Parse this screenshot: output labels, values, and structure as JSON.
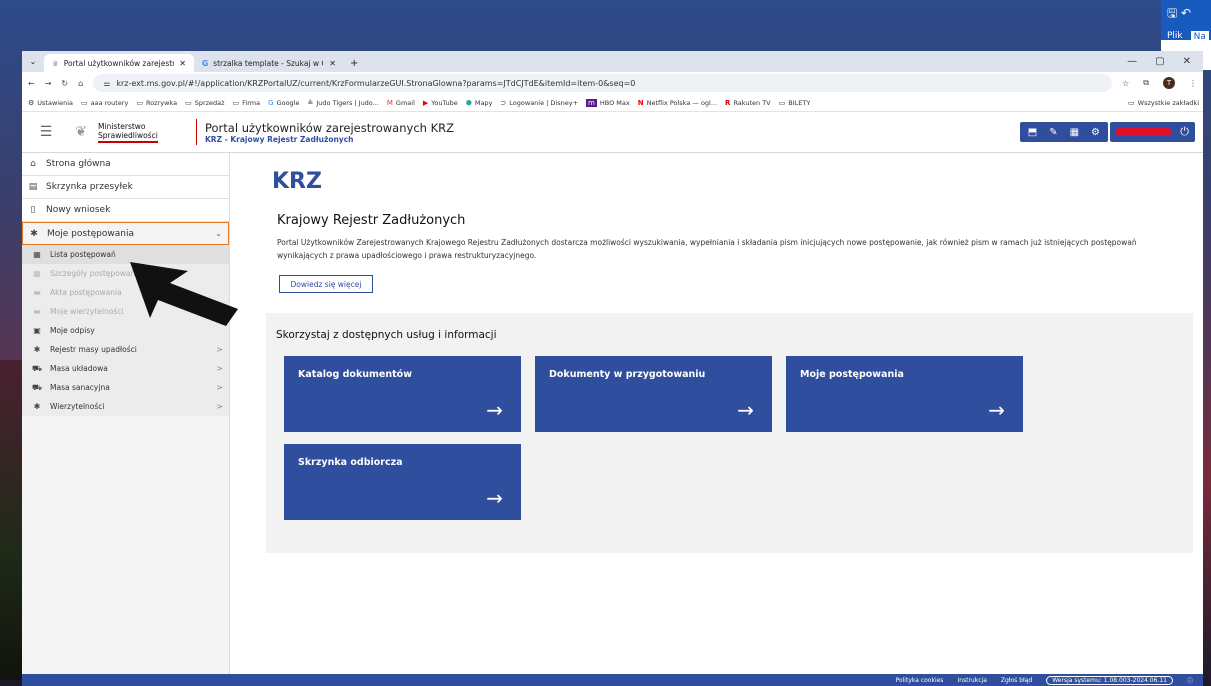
{
  "office": {
    "title_icons": "🖫 ↶",
    "tab_plik": "Plik",
    "tab_na": "Na"
  },
  "browser": {
    "tabs": [
      {
        "label": "Portal użytkowników zarejestro",
        "close": "✕"
      },
      {
        "label": "strzalka template - Szukaj w Go",
        "close": "✕"
      }
    ],
    "new_tab": "+",
    "url": "krz-ext.ms.gov.pl/#!/application/KRZPortalUZ/current/KrzFormularzeGUI.StronaGlowna?params=JTdCJTdE&itemId=item-0&seq=0",
    "avatar_letter": "T",
    "bookmarks": [
      {
        "icon": "⚙",
        "label": "Ustawienia"
      },
      {
        "icon": "▭",
        "label": "aaa routery"
      },
      {
        "icon": "▭",
        "label": "Rozrywka"
      },
      {
        "icon": "▭",
        "label": "Sprzedaż"
      },
      {
        "icon": "▭",
        "label": "Firma"
      },
      {
        "icon": "G",
        "label": "Google"
      },
      {
        "icon": "≗",
        "label": "Judo Tigers | Judo..."
      },
      {
        "icon": "M",
        "label": "Gmail"
      },
      {
        "icon": "▶",
        "label": "YouTube"
      },
      {
        "icon": "⬢",
        "label": "Mapy"
      },
      {
        "icon": "⊃",
        "label": "Logowanie | Disney+"
      },
      {
        "icon": "m",
        "label": "HBO Max"
      },
      {
        "icon": "N",
        "label": "Netflix Polska — ogl..."
      },
      {
        "icon": "R",
        "label": "Rakuten TV"
      },
      {
        "icon": "▭",
        "label": "BILETY"
      }
    ],
    "all_bookmarks": "Wszystkie zakładki"
  },
  "header": {
    "ministry": [
      "Ministerstwo",
      "Sprawiedliwości"
    ],
    "portal_title": "Portal użytkowników zarejestrowanych KRZ",
    "portal_subtitle": "KRZ - Krajowy Rejestr Zadłużonych"
  },
  "sidebar": {
    "items": [
      {
        "icon": "⌂",
        "label": "Strona główna"
      },
      {
        "icon": "▤",
        "label": "Skrzynka przesyłek"
      },
      {
        "icon": "▯",
        "label": "Nowy wniosek"
      },
      {
        "icon": "✱",
        "label": "Moje postępowania",
        "chevron": "⌄"
      }
    ],
    "sub": [
      {
        "icon": "▦",
        "label": "Lista postępowań"
      },
      {
        "icon": "▦",
        "label": "Szczegóły postępowań"
      },
      {
        "icon": "▬",
        "label": "Akta postępowania"
      },
      {
        "icon": "▬",
        "label": "Moje wierzytelności"
      },
      {
        "icon": "▣",
        "label": "Moje odpisy"
      },
      {
        "icon": "✱",
        "label": "Rejestr masy upadłości",
        "chevron": ">"
      },
      {
        "icon": "⛟",
        "label": "Masa układowa",
        "chevron": ">"
      },
      {
        "icon": "⛟",
        "label": "Masa sanacyjna",
        "chevron": ">"
      },
      {
        "icon": "✱",
        "label": "Wierzytelności",
        "chevron": ">"
      }
    ]
  },
  "main": {
    "title": "KRZ",
    "subtitle": "Krajowy Rejestr Zadłużonych",
    "description": "Portal Użytkowników Zarejestrowanych Krajowego Rejestru Zadłużonych dostarcza możliwości wyszukiwania, wypełniania i składania pism inicjujących nowe postępowanie, jak również pism w ramach już istniejących postępowań wynikających z prawa upadłościowego i prawa restrukturyzacyjnego.",
    "learn_more": "Dowiedz się więcej",
    "services_title": "Skorzystaj z dostępnych usług i informacji",
    "tiles": [
      {
        "label": "Katalog dokumentów",
        "arrow": "→"
      },
      {
        "label": "Dokumenty w przygotowaniu",
        "arrow": "→"
      },
      {
        "label": "Moje postępowania",
        "arrow": "→"
      },
      {
        "label": "Skrzynka odbiorcza",
        "arrow": "→"
      }
    ]
  },
  "footer": {
    "cookies": "Polityka cookies",
    "instructions": "Instrukcja",
    "report": "Zgłoś błąd",
    "version": "Wersja systemu: 1.08.003-2024.06.11"
  },
  "colors": {
    "accent": "#2f4e9e",
    "highlight": "#e07b2a",
    "redaction": "#e0102a"
  }
}
